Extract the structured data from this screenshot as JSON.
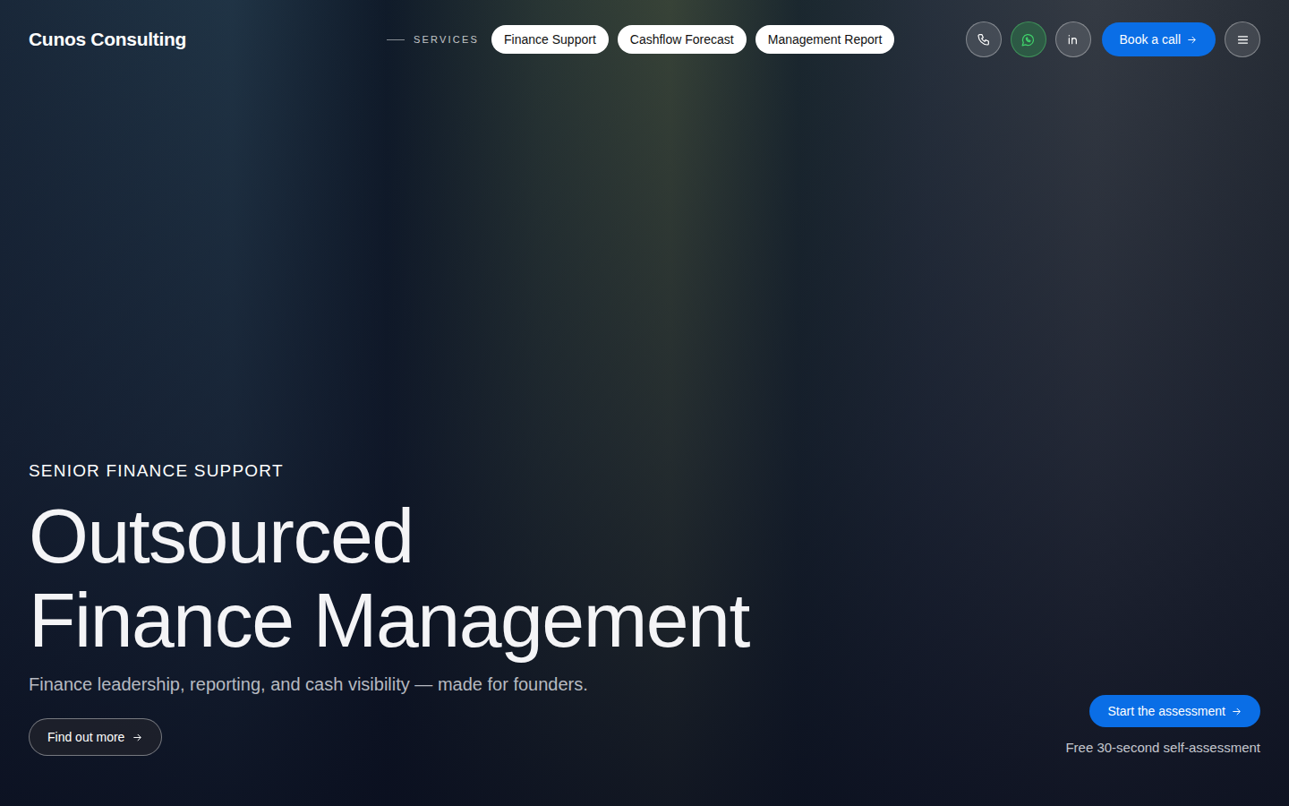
{
  "brand": "Cunos Consulting",
  "nav": {
    "label": "SERVICES",
    "items": [
      {
        "label": "Finance Support"
      },
      {
        "label": "Cashflow Forecast"
      },
      {
        "label": "Management Report"
      }
    ]
  },
  "header_cta": "Book a call",
  "hero": {
    "eyebrow": "SENIOR FINANCE SUPPORT",
    "title_lines": [
      "Outsourced",
      "Finance Management"
    ],
    "subtitle": "Finance leadership, reporting, and cash visibility — made for founders.",
    "cta": "Find out more"
  },
  "assessment": {
    "button": "Start the assessment",
    "note": "Free 30-second self-assessment"
  }
}
